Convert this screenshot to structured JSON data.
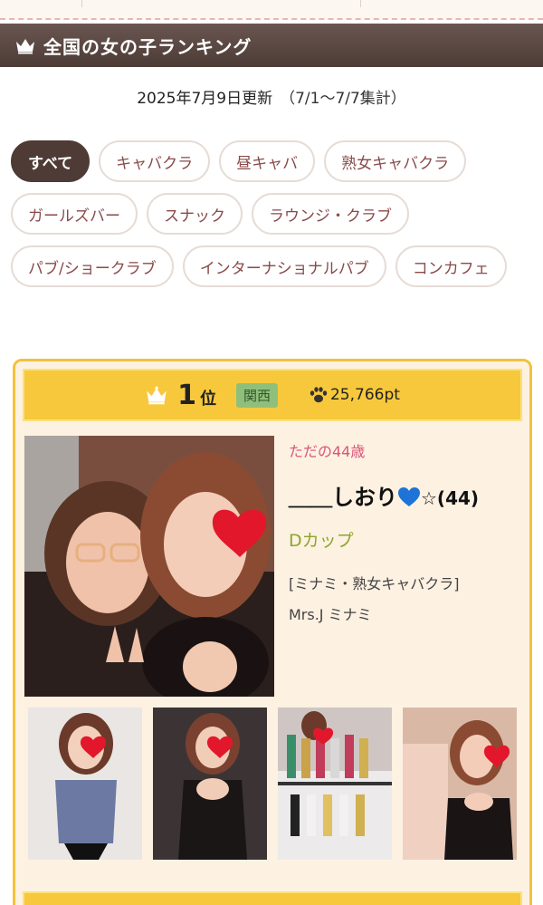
{
  "header": {
    "title": "全国の女の子ランキング",
    "crown_icon": "crown-icon"
  },
  "update": {
    "date": "2025年7月9日更新",
    "range": "（7/1〜7/7集計）"
  },
  "categories": [
    {
      "label": "すべて",
      "active": true
    },
    {
      "label": "キャバクラ"
    },
    {
      "label": "昼キャバ"
    },
    {
      "label": "熟女キャバクラ"
    },
    {
      "label": "ガールズバー"
    },
    {
      "label": "スナック"
    },
    {
      "label": "ラウンジ・クラブ"
    },
    {
      "label": "パブ/ショークラブ"
    },
    {
      "label": "インターナショナルパブ"
    },
    {
      "label": "コンカフェ"
    }
  ],
  "ranking": [
    {
      "rank": "1",
      "rank_unit": "位",
      "region": "関西",
      "points": "25,766pt",
      "catchphrase": "ただの44歳",
      "name": "＿＿しおり",
      "name_suffix": "☆(44)",
      "cup": "Dカップ",
      "shop_type": "[ミナミ・熟女キャバクラ]",
      "shop_name": "Mrs.J ミナミ"
    }
  ],
  "colors": {
    "accent_dark": "#4e3b35",
    "gold": "#f7c83c",
    "region": "#8fc07b",
    "pink": "#d9557a"
  }
}
